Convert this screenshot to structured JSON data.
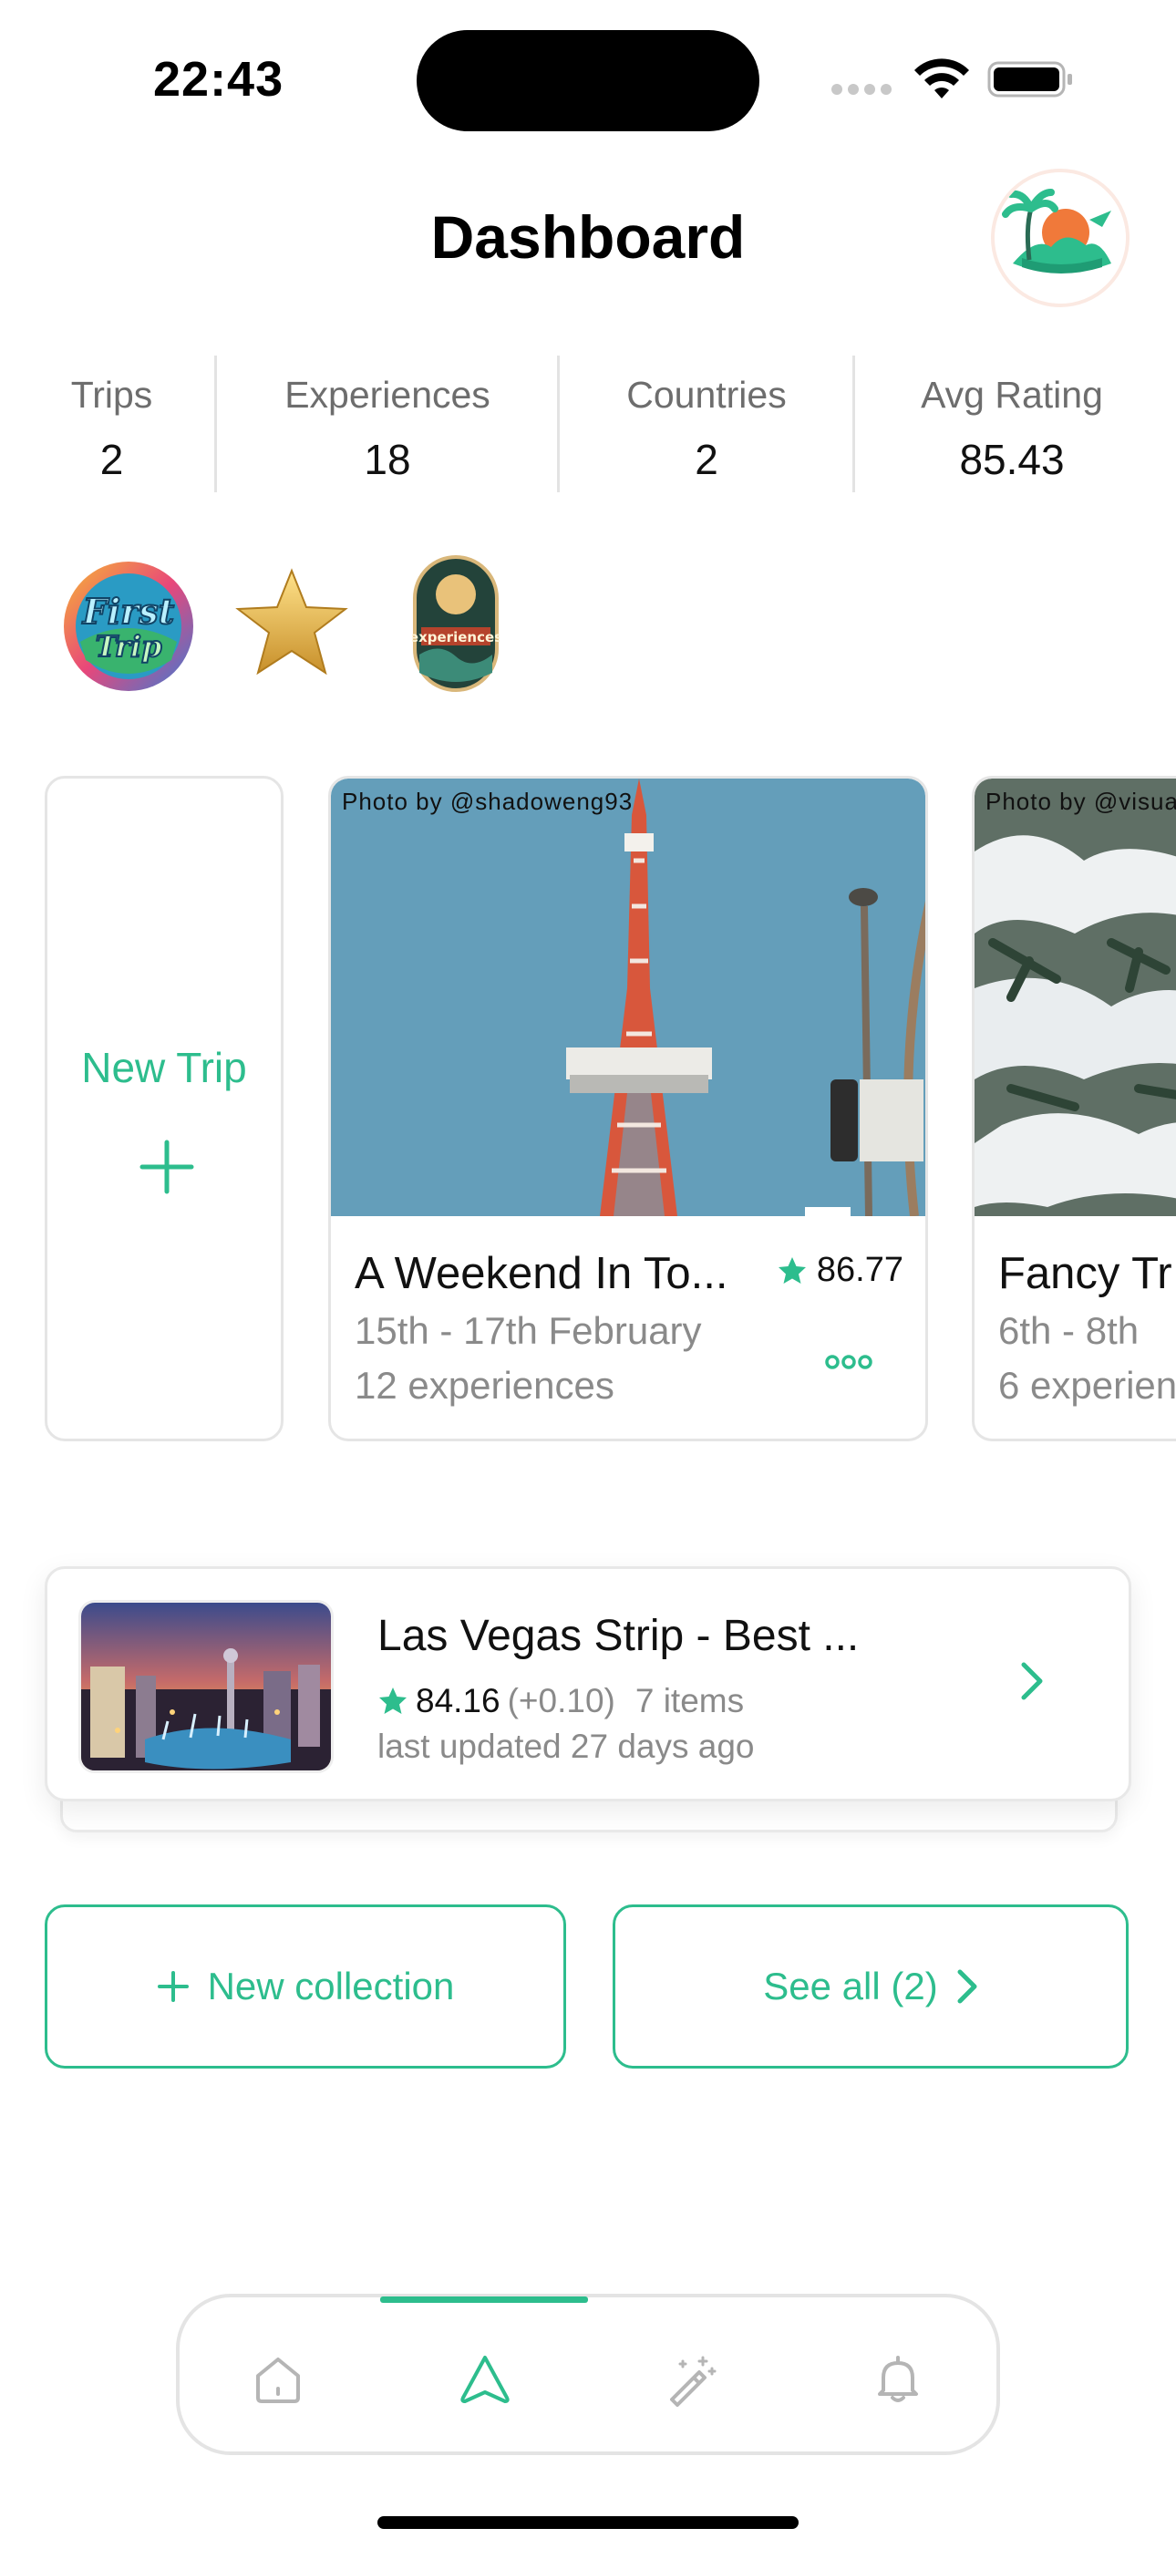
{
  "status_bar": {
    "time": "22:43"
  },
  "header": {
    "title": "Dashboard"
  },
  "stats": [
    {
      "label": "Trips",
      "value": "2"
    },
    {
      "label": "Experiences",
      "value": "18"
    },
    {
      "label": "Countries",
      "value": "2"
    },
    {
      "label": "Avg Rating",
      "value": "85.43"
    }
  ],
  "badges": [
    "first-trip-badge",
    "star-badge",
    "10-experiences-badge"
  ],
  "trips": {
    "new_trip_label": "New Trip",
    "cards": [
      {
        "photo_credit": "Photo by @shadoweng93",
        "name": "A Weekend In To...",
        "rating": "86.77",
        "dates": "15th - 17th February",
        "experiences": "12 experiences"
      },
      {
        "photo_credit": "Photo by @visua",
        "name": "Fancy Tr",
        "dates": "6th - 8th",
        "experiences": "6 experien"
      }
    ]
  },
  "collection": {
    "title": "Las Vegas Strip - Best ...",
    "rating": "84.16",
    "rating_change": "(+0.10)",
    "items": "7 items",
    "updated": "last updated 27 days ago"
  },
  "actions": {
    "new_collection": "New collection",
    "see_all": "See all (2)"
  },
  "colors": {
    "accent": "#2dbd8d",
    "text_muted": "#8a8a8a"
  },
  "tabbar": {
    "active_tab": "explore",
    "tabs": [
      "home-icon",
      "explore-icon",
      "magic-wand-icon",
      "bell-icon"
    ]
  }
}
